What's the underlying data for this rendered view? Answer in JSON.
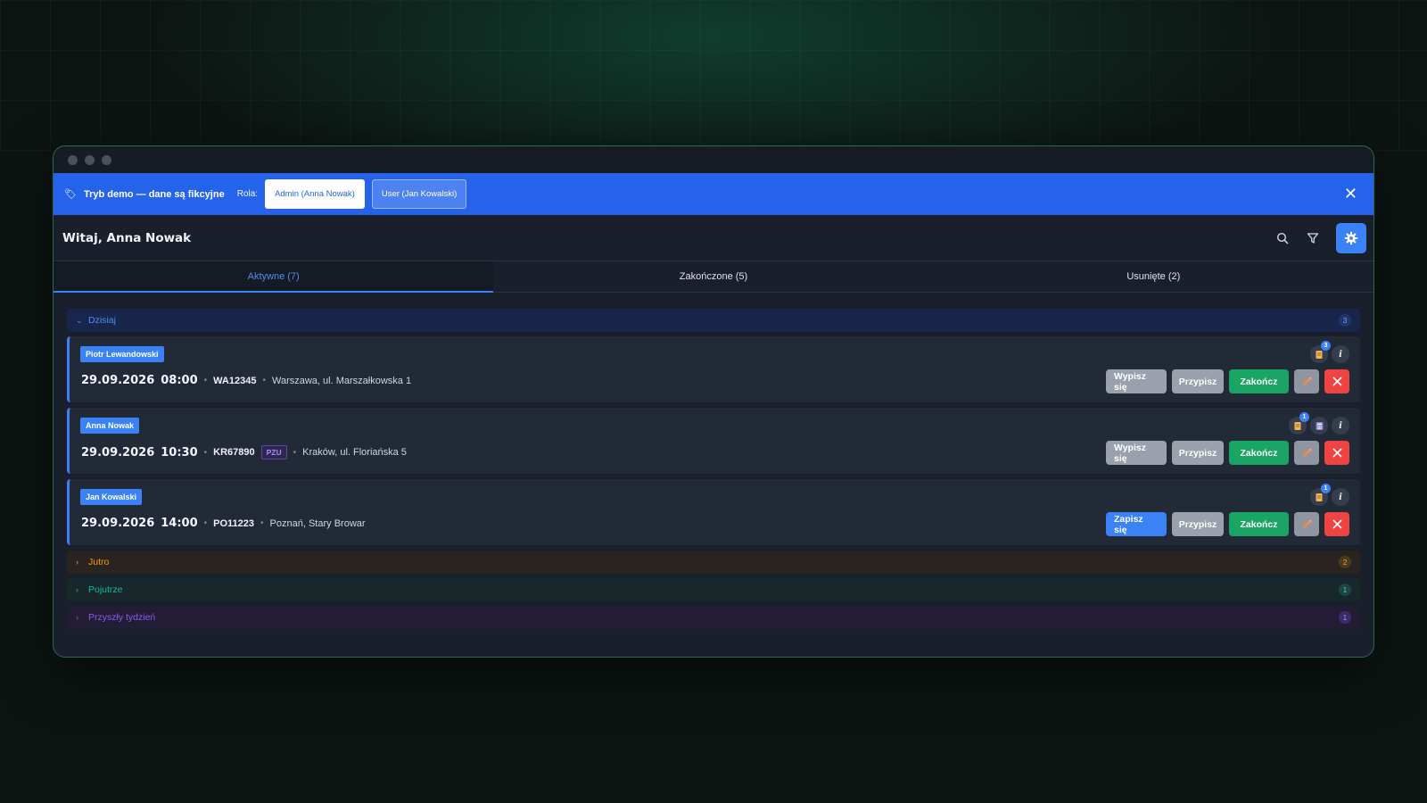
{
  "demo_banner": {
    "flag": "🏷",
    "text": "Tryb demo — dane są fikcyjne",
    "role_label": "Rola:",
    "roles": [
      {
        "label": "Admin (Anna Nowak)",
        "active": true
      },
      {
        "label": "User (Jan Kowalski)",
        "active": false
      }
    ],
    "close": "✕"
  },
  "header": {
    "greeting": "Witaj, Anna Nowak",
    "icons": [
      "search-icon",
      "filter-icon",
      "gear-icon"
    ]
  },
  "tabs": [
    {
      "label": "Aktywne (7)",
      "active": true
    },
    {
      "label": "Zakończone (5)",
      "active": false
    },
    {
      "label": "Usunięte (2)",
      "active": false
    }
  ],
  "groups": {
    "today": {
      "label": "Dzisiaj",
      "count": "3",
      "chevron": "⌄",
      "color": "#4f8df5"
    },
    "tomorrow": {
      "label": "Jutro",
      "count": "2",
      "chevron": "›",
      "color": "#f59e0b"
    },
    "after_tomorrow": {
      "label": "Pojutrze",
      "count": "1",
      "chevron": "›",
      "color": "#14b8a6"
    },
    "next_week": {
      "label": "Przyszły tydzień",
      "count": "1",
      "chevron": "›",
      "color": "#8b5cf6"
    }
  },
  "events": [
    {
      "assignee": "Piotr Lewandowski",
      "date": "29.09.2026",
      "time": "08:00",
      "code": "WA12345",
      "location": "Warszawa, ul. Marszałkowska 1",
      "doc_badge": "3",
      "signup_label": "Wypisz się",
      "assign_label": "Przypisz",
      "finish_label": "Zakończ"
    },
    {
      "assignee": "Anna Nowak",
      "date": "29.09.2026",
      "time": "10:30",
      "code": "KR67890",
      "insurer": "PZU",
      "location": "Kraków, ul. Floriańska 5",
      "doc_badge": "1",
      "signup_label": "Wypisz się",
      "assign_label": "Przypisz",
      "finish_label": "Zakończ"
    },
    {
      "assignee": "Jan Kowalski",
      "date": "29.09.2026",
      "time": "14:00",
      "code": "PO11223",
      "location": "Poznań, Stary Browar",
      "doc_badge": "1",
      "signup_label": "Zapisz się",
      "assign_label": "Przypisz",
      "finish_label": "Zakończ"
    }
  ],
  "separator": "•",
  "info_glyph": "i",
  "colors": {
    "accent": "#3b82f6",
    "banner": "#2563eb",
    "success": "#1aa564",
    "danger": "#ef4444"
  }
}
